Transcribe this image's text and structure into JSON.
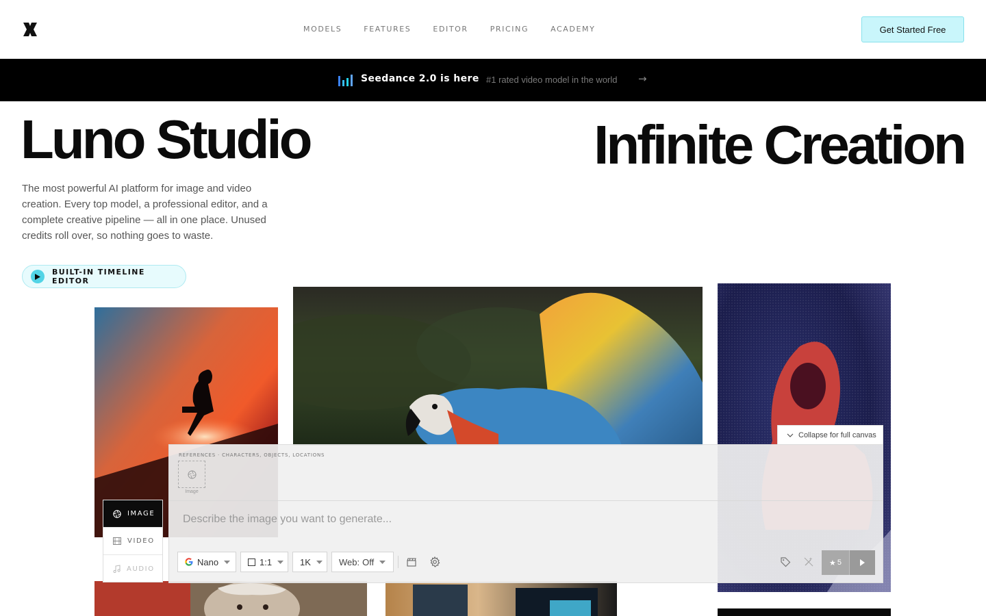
{
  "nav": {
    "logo": "luno-logo",
    "links": [
      "MODELS",
      "FEATURES",
      "EDITOR",
      "PRICING",
      "ACADEMY"
    ],
    "cta_label": "Get Started Free"
  },
  "banner": {
    "icon": "bar-chart-icon",
    "title": "Seedance 2.0 is here",
    "subtitle": "#1 rated video model in the world",
    "arrow": "→"
  },
  "hero": {
    "title": "Luno Studio",
    "tagline": "Infinite Creation",
    "description": "The most powerful AI platform for image and video creation. Every top model, a professional editor, and a complete creative pipeline — all in one place. Unused credits roll over, so nothing goes to waste.",
    "pill_label": "BUILT-IN TIMELINE EDITOR"
  },
  "composer": {
    "collapse_label": "Collapse for full canvas",
    "references_label": "REFERENCES · CHARACTERS, OBJECTS, LOCATIONS",
    "reference_caption": "Image",
    "prompt_placeholder": "Describe the image you want to generate...",
    "model": "Nano",
    "ratio": "1:1",
    "resolution": "1K",
    "web_label": "Web:",
    "web_value": "Off",
    "credits": "5",
    "modes": [
      {
        "label": "IMAGE",
        "icon": "aperture-icon",
        "active": true
      },
      {
        "label": "VIDEO",
        "icon": "film-icon",
        "active": false
      },
      {
        "label": "AUDIO",
        "icon": "music-note-icon",
        "active": false
      }
    ]
  },
  "colors": {
    "accent": "#c9f6fb",
    "accent_border": "#86e1ec",
    "banner_bg": "#000000",
    "text": "#0b0b0b"
  }
}
